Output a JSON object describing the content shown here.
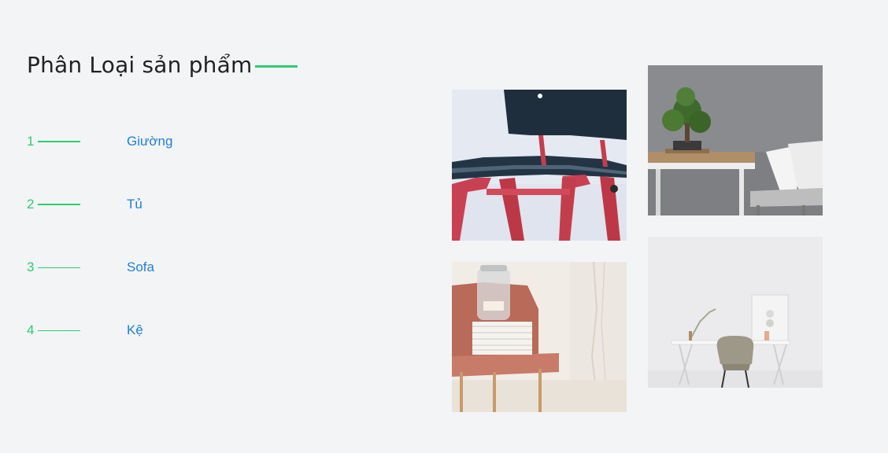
{
  "section": {
    "title": "Phân Loại sản phẩm"
  },
  "categories": [
    {
      "number": "1",
      "label": "Giường"
    },
    {
      "number": "2",
      "label": "Tủ"
    },
    {
      "number": "3",
      "label": "Sofa"
    },
    {
      "number": "4",
      "label": "Kệ"
    }
  ],
  "colors": {
    "accent": "#2ecc71",
    "link": "#1e7fd6",
    "background": "#f3f4f6",
    "title": "#222222"
  }
}
